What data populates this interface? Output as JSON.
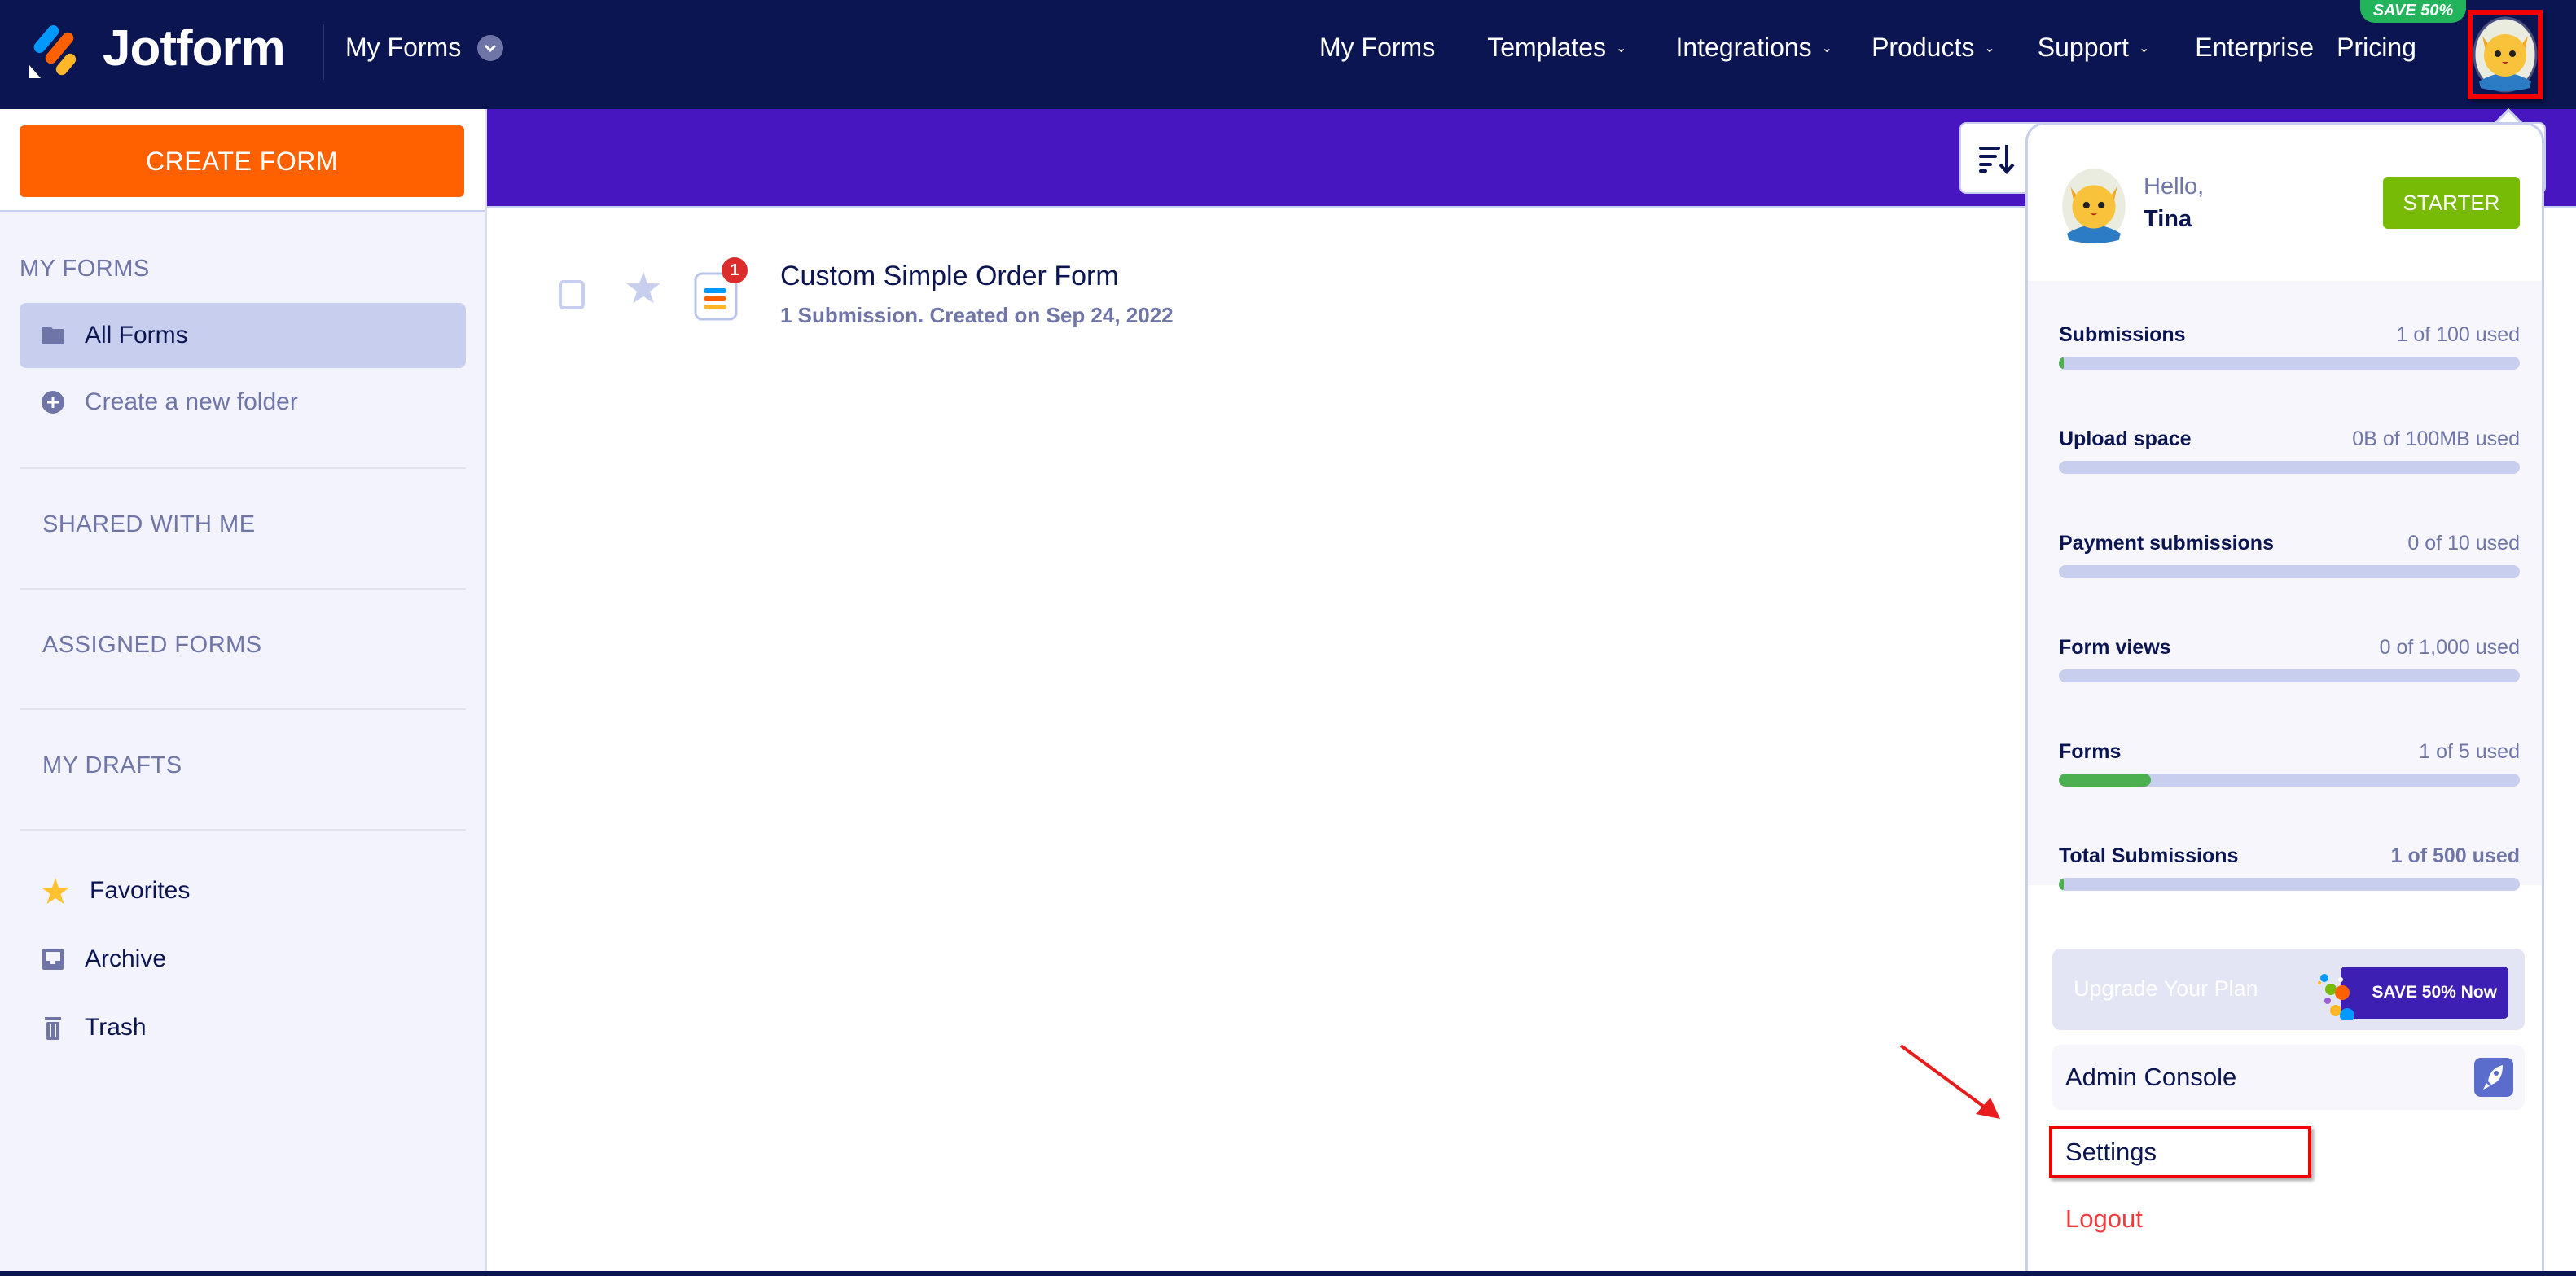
{
  "header": {
    "brand": "Jotform",
    "context_menu": "My Forms",
    "nav": [
      {
        "label": "My Forms",
        "has_dropdown": false
      },
      {
        "label": "Templates",
        "has_dropdown": true
      },
      {
        "label": "Integrations",
        "has_dropdown": true
      },
      {
        "label": "Products",
        "has_dropdown": true
      },
      {
        "label": "Support",
        "has_dropdown": true
      },
      {
        "label": "Enterprise",
        "has_dropdown": false
      },
      {
        "label": "Pricing",
        "has_dropdown": false
      }
    ],
    "promo_badge": "SAVE 50%",
    "avatar_icon": "user-avatar-cat"
  },
  "sidebar": {
    "create_button": "CREATE FORM",
    "my_forms_title": "MY FORMS",
    "all_forms": "All Forms",
    "new_folder": "Create a new folder",
    "shared_with_me": "SHARED WITH ME",
    "assigned_forms": "ASSIGNED FORMS",
    "my_drafts": "MY DRAFTS",
    "favorites": "Favorites",
    "archive": "Archive",
    "trash": "Trash"
  },
  "toolbar": {
    "sort_icon": "sort-icon"
  },
  "forms": [
    {
      "title": "Custom Simple Order Form",
      "meta": "1 Submission. Created on Sep 24, 2022",
      "new_submissions": "1"
    }
  ],
  "account_menu": {
    "greeting": "Hello,",
    "user_name": "Tina",
    "plan": "STARTER",
    "usage": [
      {
        "label": "Submissions",
        "value": "1 of 100 used",
        "fraction": 0.01
      },
      {
        "label": "Upload space",
        "value": "0B of 100MB used",
        "fraction": 0
      },
      {
        "label": "Payment submissions",
        "value": "0 of 10 used",
        "fraction": 0
      },
      {
        "label": "Form views",
        "value": "0 of 1,000 used",
        "fraction": 0
      },
      {
        "label": "Forms",
        "value": "1 of 5 used",
        "fraction": 0.2
      },
      {
        "label": "Total Submissions",
        "value": "1 of 500 used",
        "fraction": 0.002
      }
    ],
    "upgrade_label": "Upgrade Your Plan",
    "upgrade_cta": "SAVE 50% Now",
    "admin_console": "Admin Console",
    "settings": "Settings",
    "logout": "Logout"
  },
  "colors": {
    "nav_bg": "#0a1551",
    "banner": "#4716c1",
    "create": "#ff6100",
    "starter": "#78bb07",
    "progress": "#4caf50",
    "logout": "#ef3b3b",
    "highlight": "#f20000"
  }
}
